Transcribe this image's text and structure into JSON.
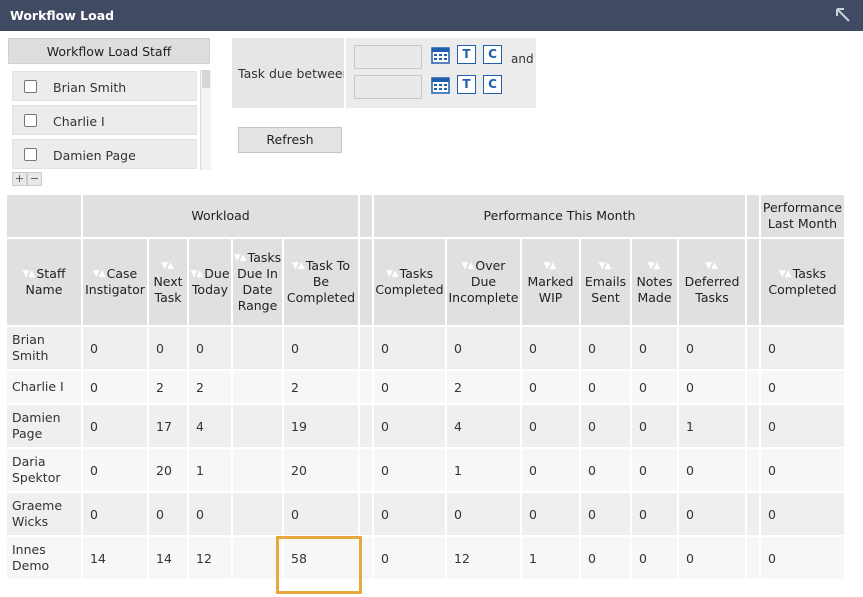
{
  "window": {
    "title": "Workflow Load"
  },
  "staff_panel": {
    "header": "Workflow Load Staff",
    "items": [
      {
        "label": "Brian Smith",
        "checked": false
      },
      {
        "label": "Charlie I",
        "checked": false
      },
      {
        "label": "Damien Page",
        "checked": false
      }
    ],
    "add_label": "+",
    "remove_label": "−"
  },
  "date_filter": {
    "label": "Task due between",
    "from_value": "",
    "to_value": "",
    "and_label": "and",
    "today_label": "T",
    "clear_label": "C"
  },
  "refresh_label": "Refresh",
  "table": {
    "groups": {
      "workload": "Workload",
      "performance_month": "Performance This Month",
      "performance_last": "Performance Last Month"
    },
    "columns": {
      "staff_name": "Staff Name",
      "case_instigator": "Case Instigator",
      "next_task": "Next Task",
      "due_today": "Due Today",
      "tasks_due_range": "Tasks Due In Date Range",
      "to_be_completed": "Task To Be Completed",
      "tasks_completed": "Tasks Completed",
      "over_due": "Over Due Incomplete",
      "marked_wip": "Marked WIP",
      "emails_sent": "Emails Sent",
      "notes_made": "Notes Made",
      "deferred": "Deferred Tasks",
      "last_tasks_completed": "Tasks Completed"
    },
    "rows": [
      {
        "name": "Brian Smith",
        "case_instigator": "0",
        "next_task": "0",
        "due_today": "0",
        "tasks_due_range": "",
        "to_be_completed": "0",
        "tasks_completed": "0",
        "over_due": "0",
        "marked_wip": "0",
        "emails_sent": "0",
        "notes_made": "0",
        "deferred": "0",
        "last_tasks_completed": "0"
      },
      {
        "name": "Charlie I",
        "case_instigator": "0",
        "next_task": "2",
        "due_today": "2",
        "tasks_due_range": "",
        "to_be_completed": "2",
        "tasks_completed": "0",
        "over_due": "2",
        "marked_wip": "0",
        "emails_sent": "0",
        "notes_made": "0",
        "deferred": "0",
        "last_tasks_completed": "0"
      },
      {
        "name": "Damien Page",
        "case_instigator": "0",
        "next_task": "17",
        "due_today": "4",
        "tasks_due_range": "",
        "to_be_completed": "19",
        "tasks_completed": "0",
        "over_due": "4",
        "marked_wip": "0",
        "emails_sent": "0",
        "notes_made": "0",
        "deferred": "1",
        "last_tasks_completed": "0"
      },
      {
        "name": "Daria Spektor",
        "case_instigator": "0",
        "next_task": "20",
        "due_today": "1",
        "tasks_due_range": "",
        "to_be_completed": "20",
        "tasks_completed": "0",
        "over_due": "1",
        "marked_wip": "0",
        "emails_sent": "0",
        "notes_made": "0",
        "deferred": "0",
        "last_tasks_completed": "0"
      },
      {
        "name": "Graeme Wicks",
        "case_instigator": "0",
        "next_task": "0",
        "due_today": "0",
        "tasks_due_range": "",
        "to_be_completed": "0",
        "tasks_completed": "0",
        "over_due": "0",
        "marked_wip": "0",
        "emails_sent": "0",
        "notes_made": "0",
        "deferred": "0",
        "last_tasks_completed": "0"
      },
      {
        "name": "Innes Demo",
        "case_instigator": "14",
        "next_task": "14",
        "due_today": "12",
        "tasks_due_range": "",
        "to_be_completed": "58",
        "tasks_completed": "0",
        "over_due": "12",
        "marked_wip": "1",
        "emails_sent": "0",
        "notes_made": "0",
        "deferred": "0",
        "last_tasks_completed": "0"
      }
    ]
  },
  "colors": {
    "titlebar": "#404a63",
    "highlight": "#e7a93b",
    "alert_value": "#d01c1c",
    "icon_blue": "#1f5fae"
  },
  "icons": [
    "collapse-arrow-icon",
    "calendar-icon",
    "today-icon",
    "clear-icon",
    "sort-arrows-icon"
  ]
}
